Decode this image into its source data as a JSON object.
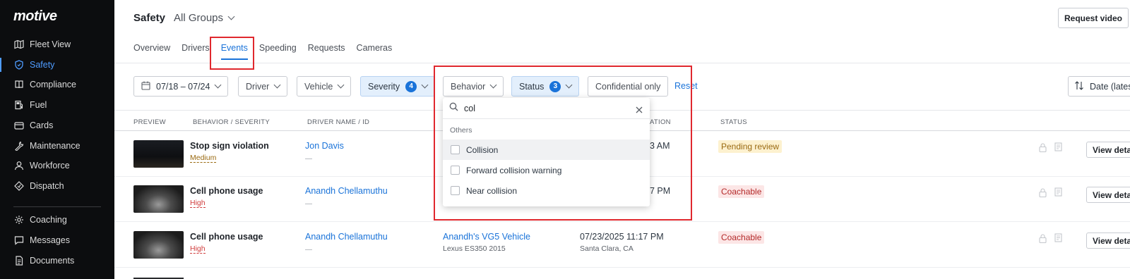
{
  "app": {
    "logo": "motive"
  },
  "sidebar": {
    "items": [
      {
        "label": "Fleet View",
        "icon": "map-icon"
      },
      {
        "label": "Safety",
        "icon": "shield-icon",
        "active": true
      },
      {
        "label": "Compliance",
        "icon": "book-icon"
      },
      {
        "label": "Fuel",
        "icon": "fuel-pump-icon"
      },
      {
        "label": "Cards",
        "icon": "credit-card-icon"
      },
      {
        "label": "Maintenance",
        "icon": "wrench-icon"
      },
      {
        "label": "Workforce",
        "icon": "person-icon"
      },
      {
        "label": "Dispatch",
        "icon": "tag-icon"
      },
      {
        "label": "Coaching",
        "icon": "gear-icon"
      },
      {
        "label": "Messages",
        "icon": "chat-icon"
      },
      {
        "label": "Documents",
        "icon": "document-icon"
      }
    ]
  },
  "header": {
    "title": "Safety",
    "group": "All Groups",
    "request_video": "Request video",
    "tabs": [
      "Overview",
      "Drivers",
      "Events",
      "Speeding",
      "Requests",
      "Cameras"
    ],
    "active_tab": "Events"
  },
  "filters": {
    "date": "07/18 – 07/24",
    "driver": "Driver",
    "vehicle": "Vehicle",
    "severity": "Severity",
    "severity_count": "4",
    "behavior": "Behavior",
    "status": "Status",
    "status_count": "3",
    "confidential": "Confidential only",
    "reset": "Reset",
    "sort": "Date (latest)"
  },
  "table": {
    "headers": {
      "preview": "PREVIEW",
      "behavior": "BEHAVIOR / SEVERITY",
      "driver": "DRIVER NAME / ID",
      "location": "ATION",
      "status": "STATUS"
    },
    "rows": [
      {
        "behavior": "Stop sign violation",
        "severity": "Medium",
        "driver": "Jon Davis",
        "driver_id": "—",
        "vehicle": "",
        "vehicle_model": "",
        "datetime": "3 AM",
        "location": "",
        "status": "Pending review",
        "action": "View details"
      },
      {
        "behavior": "Cell phone usage",
        "severity": "High",
        "driver": "Anandh Chellamuthu",
        "driver_id": "—",
        "vehicle": "",
        "vehicle_model": "",
        "datetime": "7 PM",
        "location": "",
        "status": "Coachable",
        "action": "View details"
      },
      {
        "behavior": "Cell phone usage",
        "severity": "High",
        "driver": "Anandh Chellamuthu",
        "driver_id": "—",
        "vehicle": "Anandh's VG5 Vehicle",
        "vehicle_model": "Lexus ES350 2015",
        "datetime": "07/23/2025 11:17 PM",
        "location": "Santa Clara, CA",
        "status": "Coachable",
        "action": "View details"
      }
    ]
  },
  "dropdown": {
    "search_value": "col",
    "group_label": "Others",
    "options": [
      "Collision",
      "Forward collision warning",
      "Near collision"
    ]
  },
  "colors": {
    "accent": "#1a73d9",
    "highlight": "#e0282e",
    "sidebar_bg": "#0c0d0f"
  }
}
